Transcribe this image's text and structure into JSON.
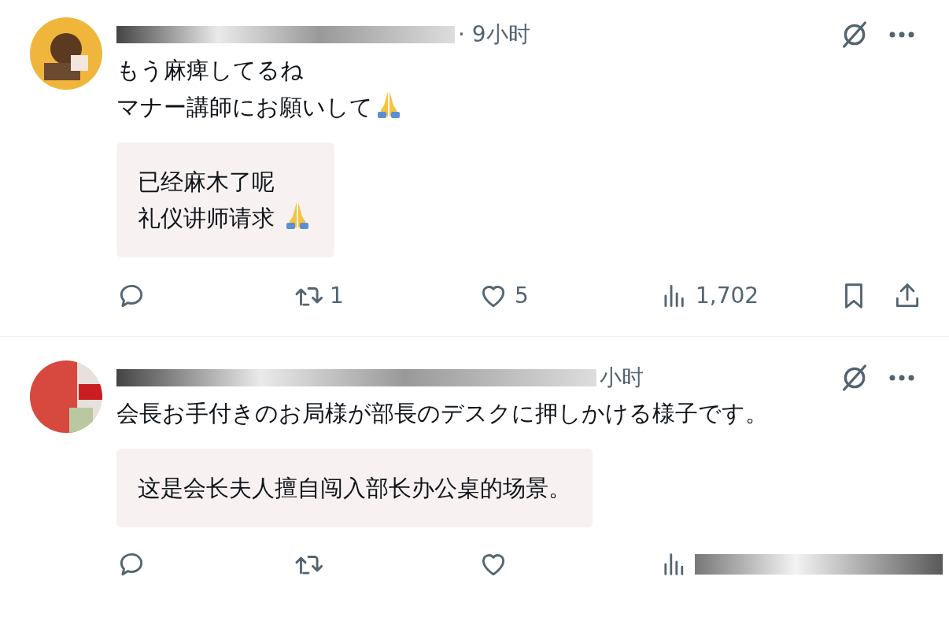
{
  "replies": [
    {
      "avatar": {
        "kind": "picture"
      },
      "time": "· 9小时",
      "lines": [
        {
          "text": "もう麻痺してるね",
          "praying_hands": false
        },
        {
          "text": "マナー講師にお願いして",
          "praying_hands": true
        }
      ],
      "translation": [
        {
          "text": "已经麻木了呢",
          "praying_hands": false
        },
        {
          "text": "礼仪讲师请求 ",
          "praying_hands": true
        }
      ],
      "actions": [
        {
          "kind": "reply"
        },
        {
          "kind": "retweet",
          "count": "1"
        },
        {
          "kind": "like",
          "count": "5"
        },
        {
          "kind": "views",
          "count": "1,702"
        },
        {
          "kind": "bookmark"
        },
        {
          "kind": "share"
        }
      ]
    },
    {
      "avatar": {
        "kind": "picture"
      },
      "time": "小时",
      "lines": [
        {
          "text": "会長お手付きのお局様が部長のデスクに押しかける様子です。",
          "praying_hands": false
        }
      ],
      "translation": [
        {
          "text": "这是会长夫人擅自闯入部长办公桌的场景。",
          "praying_hands": false
        }
      ],
      "actions": [
        {
          "kind": "reply"
        },
        {
          "kind": "retweet"
        },
        {
          "kind": "like"
        },
        {
          "kind": "views_redacted"
        }
      ]
    }
  ]
}
